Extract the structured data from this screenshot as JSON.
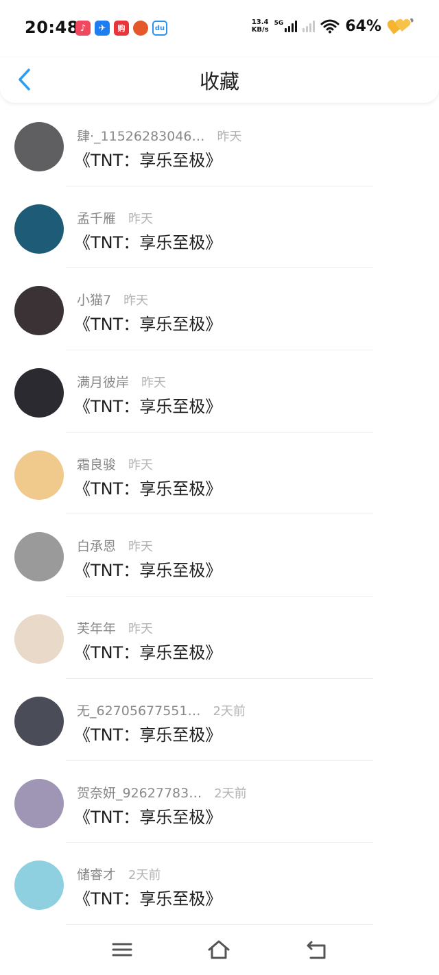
{
  "status": {
    "time": "20:48",
    "net_speed_value": "13.4",
    "net_speed_unit": "KB/s",
    "network_type": "5G",
    "battery": "64%",
    "app_icons": [
      {
        "name": "douyin-icon",
        "color": "#f0485f",
        "glyph": "♪"
      },
      {
        "name": "dingtalk-icon",
        "color": "#1e7ef1",
        "glyph": "✈"
      },
      {
        "name": "shop-icon",
        "color": "#e8343b",
        "glyph": "购"
      },
      {
        "name": "game-icon",
        "color": "#e4582b",
        "glyph": "●"
      },
      {
        "name": "baidu-icon",
        "color": "#2d8ff0",
        "glyph": "du"
      }
    ]
  },
  "header": {
    "title": "收藏"
  },
  "items": [
    {
      "name": "肆·_11526283046…",
      "time": "昨天",
      "book": "《TNT：享乐至极》",
      "avatar": "#5f5f61"
    },
    {
      "name": "孟千雁",
      "time": "昨天",
      "book": "《TNT：享乐至极》",
      "avatar": "#1e5b76"
    },
    {
      "name": "小猫7",
      "time": "昨天",
      "book": "《TNT：享乐至极》",
      "avatar": "#3a3234"
    },
    {
      "name": "满月彼岸",
      "time": "昨天",
      "book": "《TNT：享乐至极》",
      "avatar": "#2a2a30"
    },
    {
      "name": "霜良骏",
      "time": "昨天",
      "book": "《TNT：享乐至极》",
      "avatar": "#f0c98c"
    },
    {
      "name": "白承恩",
      "time": "昨天",
      "book": "《TNT：享乐至极》",
      "avatar": "#9a9a9a"
    },
    {
      "name": "芙年年",
      "time": "昨天",
      "book": "《TNT：享乐至极》",
      "avatar": "#e9d9c8"
    },
    {
      "name": "无_62705677551…",
      "time": "2天前",
      "book": "《TNT：享乐至极》",
      "avatar": "#4a4c58"
    },
    {
      "name": "贺奈妍_92627783…",
      "time": "2天前",
      "book": "《TNT：享乐至极》",
      "avatar": "#9f96b5"
    },
    {
      "name": "储睿才",
      "time": "2天前",
      "book": "《TNT：享乐至极》",
      "avatar": "#8fd0e0"
    }
  ],
  "colors": {
    "accent": "#2b9cf0",
    "name_text": "#888888",
    "time_text": "#b3b3b3",
    "battery_heart": "#f5b531"
  }
}
